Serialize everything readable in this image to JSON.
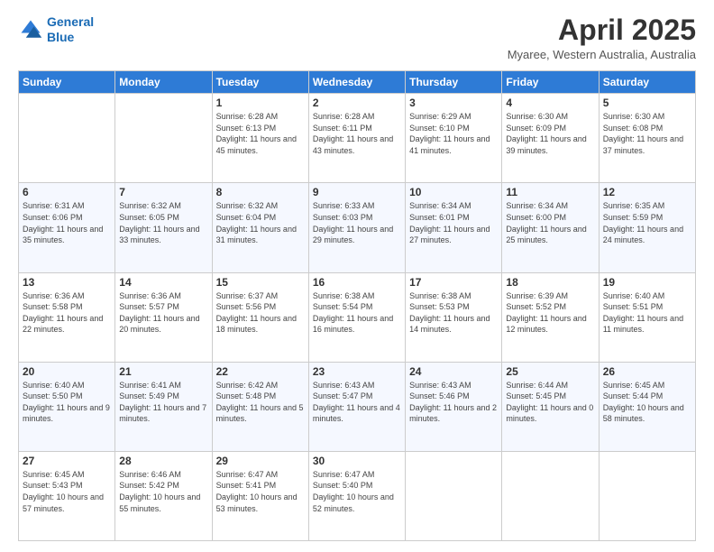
{
  "header": {
    "logo_line1": "General",
    "logo_line2": "Blue",
    "title": "April 2025",
    "subtitle": "Myaree, Western Australia, Australia"
  },
  "days_of_week": [
    "Sunday",
    "Monday",
    "Tuesday",
    "Wednesday",
    "Thursday",
    "Friday",
    "Saturday"
  ],
  "weeks": [
    [
      {
        "num": "",
        "sunrise": "",
        "sunset": "",
        "daylight": ""
      },
      {
        "num": "",
        "sunrise": "",
        "sunset": "",
        "daylight": ""
      },
      {
        "num": "1",
        "sunrise": "Sunrise: 6:28 AM",
        "sunset": "Sunset: 6:13 PM",
        "daylight": "Daylight: 11 hours and 45 minutes."
      },
      {
        "num": "2",
        "sunrise": "Sunrise: 6:28 AM",
        "sunset": "Sunset: 6:11 PM",
        "daylight": "Daylight: 11 hours and 43 minutes."
      },
      {
        "num": "3",
        "sunrise": "Sunrise: 6:29 AM",
        "sunset": "Sunset: 6:10 PM",
        "daylight": "Daylight: 11 hours and 41 minutes."
      },
      {
        "num": "4",
        "sunrise": "Sunrise: 6:30 AM",
        "sunset": "Sunset: 6:09 PM",
        "daylight": "Daylight: 11 hours and 39 minutes."
      },
      {
        "num": "5",
        "sunrise": "Sunrise: 6:30 AM",
        "sunset": "Sunset: 6:08 PM",
        "daylight": "Daylight: 11 hours and 37 minutes."
      }
    ],
    [
      {
        "num": "6",
        "sunrise": "Sunrise: 6:31 AM",
        "sunset": "Sunset: 6:06 PM",
        "daylight": "Daylight: 11 hours and 35 minutes."
      },
      {
        "num": "7",
        "sunrise": "Sunrise: 6:32 AM",
        "sunset": "Sunset: 6:05 PM",
        "daylight": "Daylight: 11 hours and 33 minutes."
      },
      {
        "num": "8",
        "sunrise": "Sunrise: 6:32 AM",
        "sunset": "Sunset: 6:04 PM",
        "daylight": "Daylight: 11 hours and 31 minutes."
      },
      {
        "num": "9",
        "sunrise": "Sunrise: 6:33 AM",
        "sunset": "Sunset: 6:03 PM",
        "daylight": "Daylight: 11 hours and 29 minutes."
      },
      {
        "num": "10",
        "sunrise": "Sunrise: 6:34 AM",
        "sunset": "Sunset: 6:01 PM",
        "daylight": "Daylight: 11 hours and 27 minutes."
      },
      {
        "num": "11",
        "sunrise": "Sunrise: 6:34 AM",
        "sunset": "Sunset: 6:00 PM",
        "daylight": "Daylight: 11 hours and 25 minutes."
      },
      {
        "num": "12",
        "sunrise": "Sunrise: 6:35 AM",
        "sunset": "Sunset: 5:59 PM",
        "daylight": "Daylight: 11 hours and 24 minutes."
      }
    ],
    [
      {
        "num": "13",
        "sunrise": "Sunrise: 6:36 AM",
        "sunset": "Sunset: 5:58 PM",
        "daylight": "Daylight: 11 hours and 22 minutes."
      },
      {
        "num": "14",
        "sunrise": "Sunrise: 6:36 AM",
        "sunset": "Sunset: 5:57 PM",
        "daylight": "Daylight: 11 hours and 20 minutes."
      },
      {
        "num": "15",
        "sunrise": "Sunrise: 6:37 AM",
        "sunset": "Sunset: 5:56 PM",
        "daylight": "Daylight: 11 hours and 18 minutes."
      },
      {
        "num": "16",
        "sunrise": "Sunrise: 6:38 AM",
        "sunset": "Sunset: 5:54 PM",
        "daylight": "Daylight: 11 hours and 16 minutes."
      },
      {
        "num": "17",
        "sunrise": "Sunrise: 6:38 AM",
        "sunset": "Sunset: 5:53 PM",
        "daylight": "Daylight: 11 hours and 14 minutes."
      },
      {
        "num": "18",
        "sunrise": "Sunrise: 6:39 AM",
        "sunset": "Sunset: 5:52 PM",
        "daylight": "Daylight: 11 hours and 12 minutes."
      },
      {
        "num": "19",
        "sunrise": "Sunrise: 6:40 AM",
        "sunset": "Sunset: 5:51 PM",
        "daylight": "Daylight: 11 hours and 11 minutes."
      }
    ],
    [
      {
        "num": "20",
        "sunrise": "Sunrise: 6:40 AM",
        "sunset": "Sunset: 5:50 PM",
        "daylight": "Daylight: 11 hours and 9 minutes."
      },
      {
        "num": "21",
        "sunrise": "Sunrise: 6:41 AM",
        "sunset": "Sunset: 5:49 PM",
        "daylight": "Daylight: 11 hours and 7 minutes."
      },
      {
        "num": "22",
        "sunrise": "Sunrise: 6:42 AM",
        "sunset": "Sunset: 5:48 PM",
        "daylight": "Daylight: 11 hours and 5 minutes."
      },
      {
        "num": "23",
        "sunrise": "Sunrise: 6:43 AM",
        "sunset": "Sunset: 5:47 PM",
        "daylight": "Daylight: 11 hours and 4 minutes."
      },
      {
        "num": "24",
        "sunrise": "Sunrise: 6:43 AM",
        "sunset": "Sunset: 5:46 PM",
        "daylight": "Daylight: 11 hours and 2 minutes."
      },
      {
        "num": "25",
        "sunrise": "Sunrise: 6:44 AM",
        "sunset": "Sunset: 5:45 PM",
        "daylight": "Daylight: 11 hours and 0 minutes."
      },
      {
        "num": "26",
        "sunrise": "Sunrise: 6:45 AM",
        "sunset": "Sunset: 5:44 PM",
        "daylight": "Daylight: 10 hours and 58 minutes."
      }
    ],
    [
      {
        "num": "27",
        "sunrise": "Sunrise: 6:45 AM",
        "sunset": "Sunset: 5:43 PM",
        "daylight": "Daylight: 10 hours and 57 minutes."
      },
      {
        "num": "28",
        "sunrise": "Sunrise: 6:46 AM",
        "sunset": "Sunset: 5:42 PM",
        "daylight": "Daylight: 10 hours and 55 minutes."
      },
      {
        "num": "29",
        "sunrise": "Sunrise: 6:47 AM",
        "sunset": "Sunset: 5:41 PM",
        "daylight": "Daylight: 10 hours and 53 minutes."
      },
      {
        "num": "30",
        "sunrise": "Sunrise: 6:47 AM",
        "sunset": "Sunset: 5:40 PM",
        "daylight": "Daylight: 10 hours and 52 minutes."
      },
      {
        "num": "",
        "sunrise": "",
        "sunset": "",
        "daylight": ""
      },
      {
        "num": "",
        "sunrise": "",
        "sunset": "",
        "daylight": ""
      },
      {
        "num": "",
        "sunrise": "",
        "sunset": "",
        "daylight": ""
      }
    ]
  ]
}
